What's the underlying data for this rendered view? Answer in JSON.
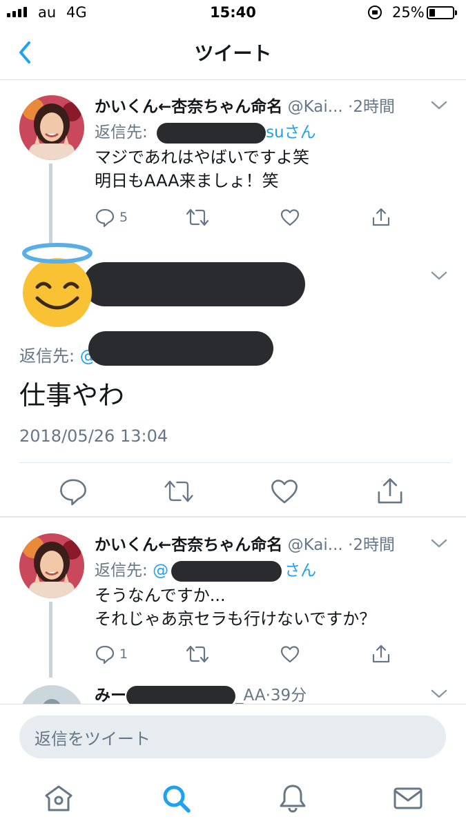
{
  "status_bar": {
    "carrier": "au",
    "network": "4G",
    "time": "15:40",
    "battery_percent_label": "25%",
    "battery_level": 0.25
  },
  "nav": {
    "title": "ツイート"
  },
  "tweets": [
    {
      "name": "かいくん←杏奈ちゃん命名",
      "handle": "@Kai...",
      "dot": "·",
      "time": "2時間",
      "reply_prefix": "返信先:",
      "reply_suffix": "suさん",
      "lines": [
        "マジであれはやばいですよ笑",
        "明日もAAA来ましょ！笑"
      ],
      "reply_count": "5"
    },
    {
      "name": "かいくん←杏奈ちゃん命名",
      "handle": "@Kai...",
      "dot": "·",
      "time": "2時間",
      "reply_prefix": "返信先:",
      "reply_mention_start": "@",
      "reply_suffix": "さん",
      "lines": [
        "そうなんですか...",
        "それじゃあ京セラも行けないですか？"
      ],
      "reply_count": "1"
    },
    {
      "name_start": "みー",
      "handle_end": "_AA",
      "dot": "·",
      "time": "39分"
    }
  ],
  "focus_tweet": {
    "reply_prefix": "返信先:",
    "reply_mention_start": "@",
    "text": "仕事やわ",
    "date": "2018/05/26 13:04"
  },
  "composer": {
    "placeholder": "返信をツイート"
  },
  "colors": {
    "accent": "#1da1f2",
    "muted": "#657786",
    "redaction": "#292b2e"
  },
  "icons": {
    "tabs": [
      "home-icon",
      "search-icon",
      "notifications-icon",
      "messages-icon"
    ],
    "actions": [
      "reply-icon",
      "retweet-icon",
      "like-icon",
      "share-icon"
    ]
  }
}
